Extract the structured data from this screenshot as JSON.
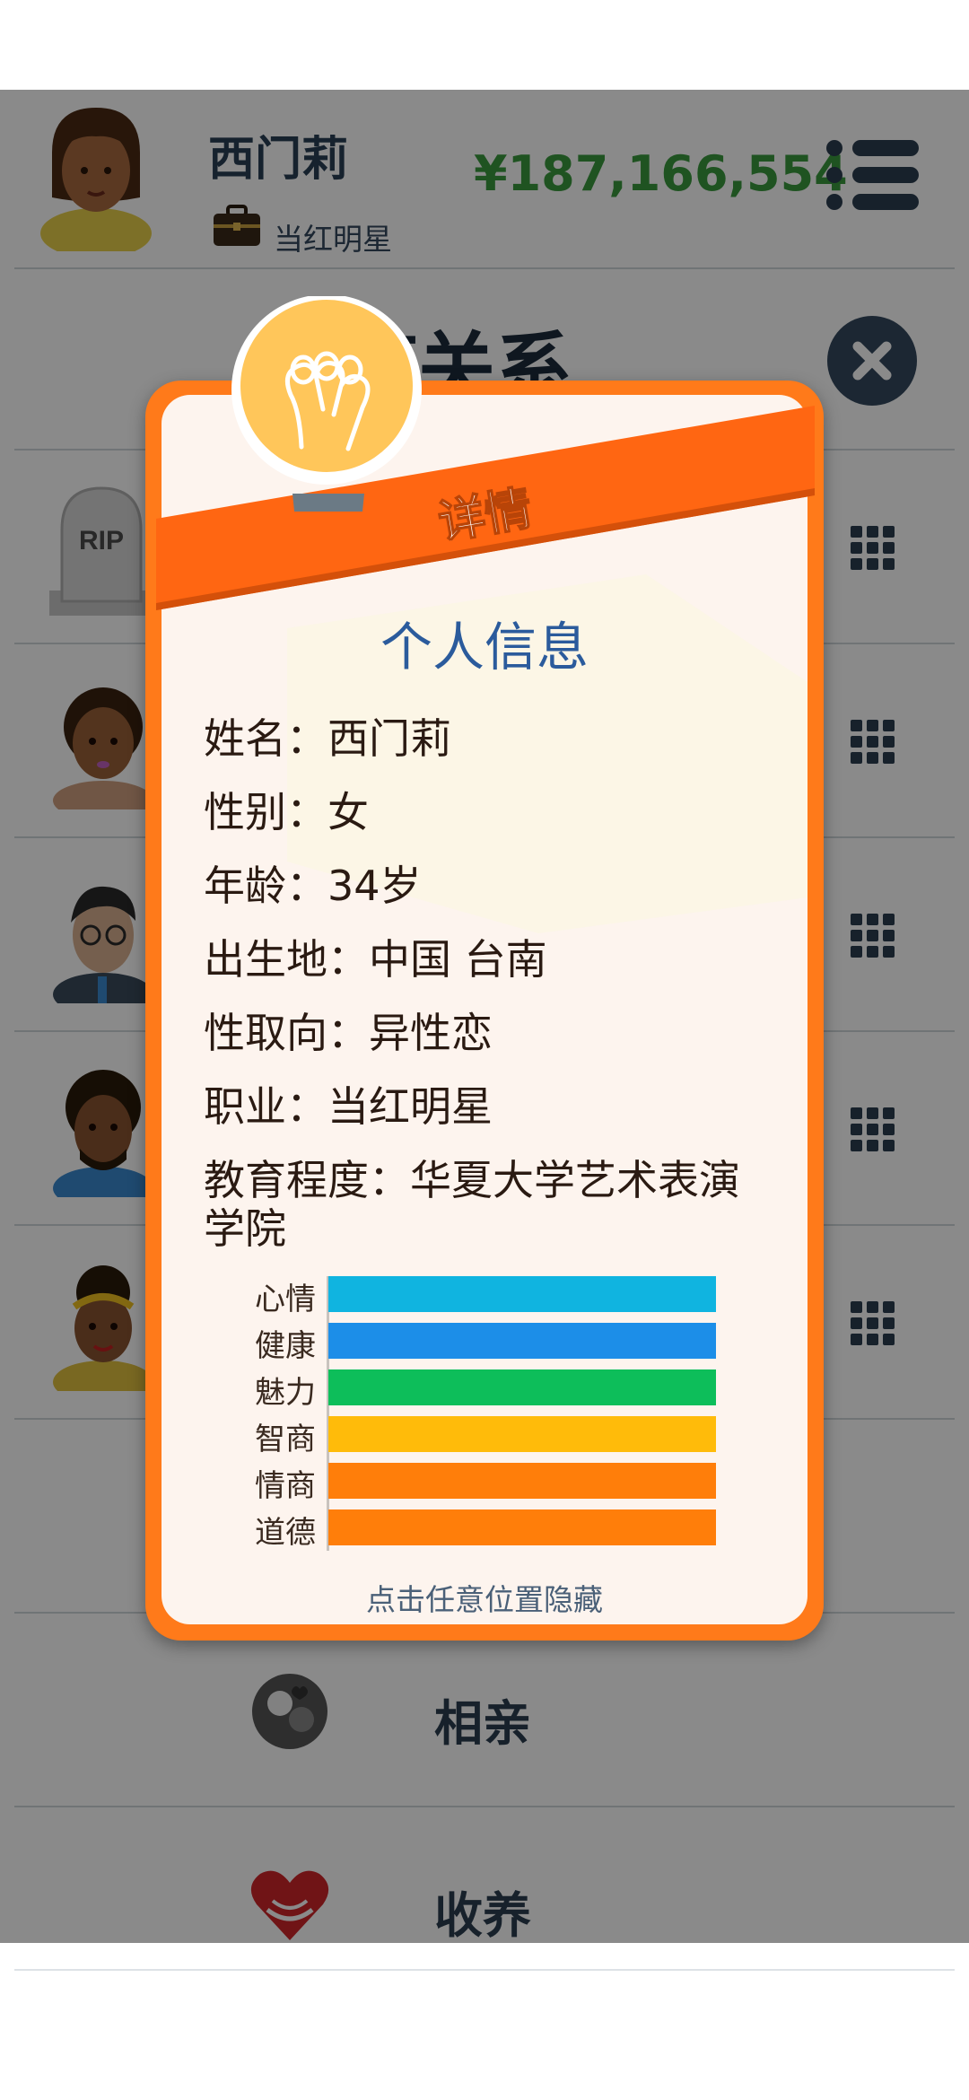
{
  "header": {
    "player_name": "西门莉",
    "job": "当红明星",
    "money": "¥187,166,554"
  },
  "page": {
    "section_title": "庭关系"
  },
  "relations": [
    {
      "type": "tombstone",
      "tomb_text": "RIP"
    },
    {
      "type": "person"
    },
    {
      "type": "person"
    },
    {
      "type": "person"
    },
    {
      "type": "person"
    }
  ],
  "bottom_items": [
    {
      "label": "相亲",
      "icon": "couple-icon"
    },
    {
      "label": "收养",
      "icon": "heart-hands-icon"
    }
  ],
  "modal": {
    "banner": "详情",
    "title": "个人信息",
    "info": [
      "姓名：西门莉",
      "性别：女",
      "年龄：34岁",
      "出生地：中国 台南",
      "性取向：异性恋",
      "职业：当红明星",
      "教育程度：华夏大学艺术表演",
      "学院"
    ],
    "stats": [
      {
        "label": "心情",
        "value": 100,
        "color": "#10b4e0"
      },
      {
        "label": "健康",
        "value": 100,
        "color": "#1c8ee8"
      },
      {
        "label": "魅力",
        "value": 100,
        "color": "#0dbe5a"
      },
      {
        "label": "智商",
        "value": 100,
        "color": "#ffbb0a"
      },
      {
        "label": "情商",
        "value": 100,
        "color": "#ff7e0a"
      },
      {
        "label": "道德",
        "value": 100,
        "color": "#ff7e0a"
      }
    ],
    "hint": "点击任意位置隐藏"
  }
}
